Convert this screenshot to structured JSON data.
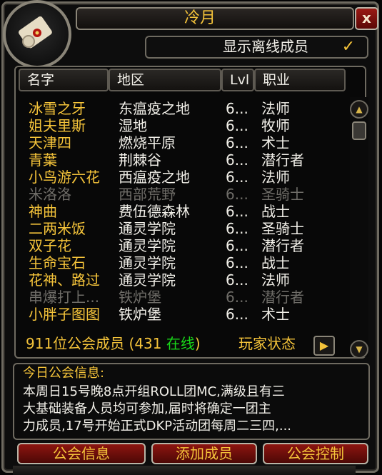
{
  "window": {
    "title": "冷月",
    "close_label": "x"
  },
  "offline_toggle": {
    "label": "显示离线成员",
    "check_glyph": "✓",
    "checked": true
  },
  "columns": {
    "name": "名字",
    "zone": "地区",
    "level": "Lvl",
    "class": "职业"
  },
  "rows": [
    {
      "name": "冰雪之牙",
      "zone": "东瘟疫之地",
      "level": "6...",
      "class": "法师",
      "online": true
    },
    {
      "name": "姐夫里斯",
      "zone": "湿地",
      "level": "6...",
      "class": "牧师",
      "online": true
    },
    {
      "name": "天津四",
      "zone": "燃烧平原",
      "level": "6...",
      "class": "术士",
      "online": true
    },
    {
      "name": "青葉",
      "zone": "荆棘谷",
      "level": "6...",
      "class": "潜行者",
      "online": true
    },
    {
      "name": "小鸟游六花",
      "zone": "西瘟疫之地",
      "level": "6...",
      "class": "法师",
      "online": true
    },
    {
      "name": "米洛洛",
      "zone": "西部荒野",
      "level": "6...",
      "class": "圣骑士",
      "online": false
    },
    {
      "name": "神曲",
      "zone": "费伍德森林",
      "level": "6...",
      "class": "战士",
      "online": true
    },
    {
      "name": "二两米饭",
      "zone": "通灵学院",
      "level": "6...",
      "class": "圣骑士",
      "online": true
    },
    {
      "name": "双子花",
      "zone": "通灵学院",
      "level": "6...",
      "class": "潜行者",
      "online": true
    },
    {
      "name": "生命宝石",
      "zone": "通灵学院",
      "level": "6...",
      "class": "战士",
      "online": true
    },
    {
      "name": "花神、路过",
      "zone": "通灵学院",
      "level": "6...",
      "class": "法师",
      "online": true
    },
    {
      "name": "串爆打上...",
      "zone": "铁炉堡",
      "level": "6...",
      "class": "潜行者",
      "online": false
    },
    {
      "name": "小胖子图图",
      "zone": "铁炉堡",
      "level": "6...",
      "class": "术士",
      "online": true
    }
  ],
  "footer": {
    "member_text": "911位公会成员 (431 ",
    "online_text": "在线",
    "member_close": ")",
    "player_status": "玩家状态",
    "arrow_glyph": "▶"
  },
  "motd": {
    "title": "今日公会信息:",
    "lines": [
      "本周日15号晚8点开组ROLL团MC,满级且有三",
      "大基础装备人员均可参加,届时将确定一团主",
      "力成员,17号开始正式DKP活动团每周二三四,..."
    ]
  },
  "buttons": {
    "guild_info": "公会信息",
    "add_member": "添加成员",
    "guild_control": "公会控制"
  },
  "colors": {
    "gold": "#f4c33a",
    "white": "#f1efe8",
    "offline": "#6f6d68",
    "online_green": "#19d819",
    "button_red": "#8d1510"
  },
  "icons": {
    "portrait": "scroll-charter-icon",
    "scroll_up": "scroll-up-icon",
    "scroll_down": "scroll-down-icon"
  }
}
